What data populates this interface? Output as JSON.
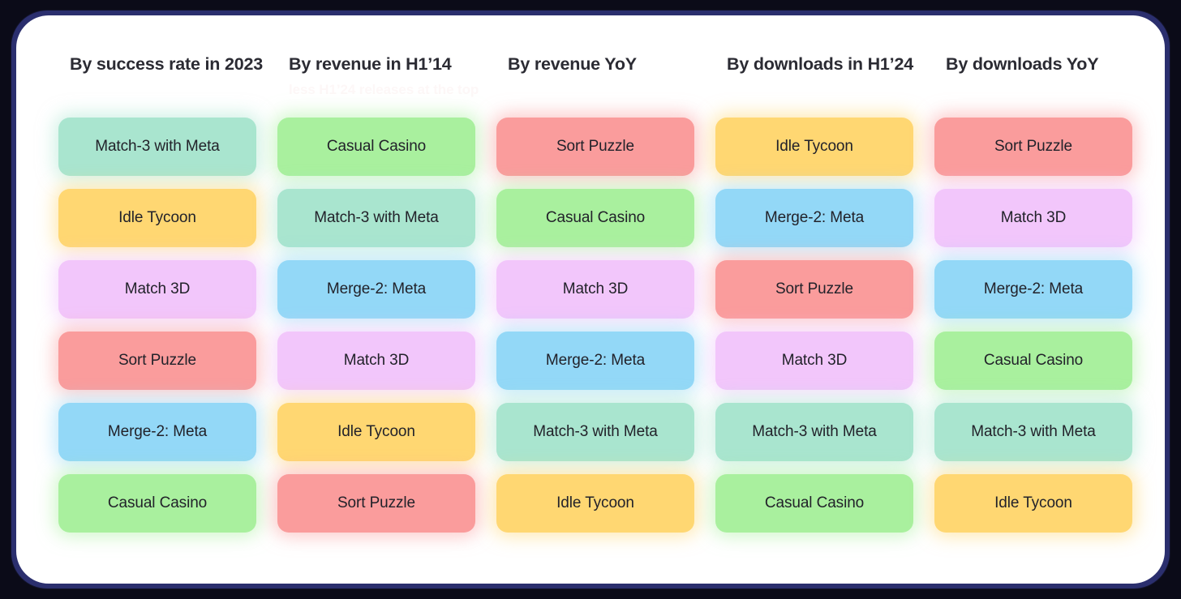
{
  "palette": {
    "background": "#0b0b18",
    "card": "#ffffff",
    "border_ring": "#2b2f6e",
    "title_text": "#2b2b33",
    "cell_text": "#22222a",
    "subtitle_text": "#fdf7f7",
    "mint": "#a9e5cf",
    "yellow": "#ffd772",
    "purple": "#f2c6fb",
    "salmon": "#fa9c9c",
    "sky": "#93d8f7",
    "green": "#a9f09e"
  },
  "columns": [
    {
      "title": "By success rate in 2023",
      "subtitle": "",
      "cells": [
        {
          "label": "Match-3 with Meta",
          "color": "mint"
        },
        {
          "label": "Idle Tycoon",
          "color": "yellow"
        },
        {
          "label": "Match 3D",
          "color": "purple"
        },
        {
          "label": "Sort Puzzle",
          "color": "salmon"
        },
        {
          "label": "Merge-2: Meta",
          "color": "sky"
        },
        {
          "label": "Casual Casino",
          "color": "green"
        }
      ]
    },
    {
      "title": "By revenue in H1’14",
      "subtitle": "less H1’24 releases at the top",
      "cells": [
        {
          "label": "Casual Casino",
          "color": "green"
        },
        {
          "label": "Match-3 with Meta",
          "color": "mint"
        },
        {
          "label": "Merge-2: Meta",
          "color": "sky"
        },
        {
          "label": "Match 3D",
          "color": "purple"
        },
        {
          "label": "Idle Tycoon",
          "color": "yellow"
        },
        {
          "label": "Sort Puzzle",
          "color": "salmon"
        }
      ]
    },
    {
      "title": "By revenue YoY",
      "subtitle": "",
      "cells": [
        {
          "label": "Sort Puzzle",
          "color": "salmon"
        },
        {
          "label": "Casual Casino",
          "color": "green"
        },
        {
          "label": "Match 3D",
          "color": "purple"
        },
        {
          "label": "Merge-2: Meta",
          "color": "sky"
        },
        {
          "label": "Match-3 with Meta",
          "color": "mint"
        },
        {
          "label": "Idle Tycoon",
          "color": "yellow"
        }
      ]
    },
    {
      "title": "By downloads in H1’24",
      "subtitle": "",
      "cells": [
        {
          "label": "Idle Tycoon",
          "color": "yellow"
        },
        {
          "label": "Merge-2: Meta",
          "color": "sky"
        },
        {
          "label": "Sort Puzzle",
          "color": "salmon"
        },
        {
          "label": "Match 3D",
          "color": "purple"
        },
        {
          "label": "Match-3 with Meta",
          "color": "mint"
        },
        {
          "label": "Casual Casino",
          "color": "green"
        }
      ]
    },
    {
      "title": "By downloads YoY",
      "subtitle": "",
      "cells": [
        {
          "label": "Sort Puzzle",
          "color": "salmon"
        },
        {
          "label": "Match 3D",
          "color": "purple"
        },
        {
          "label": "Merge-2: Meta",
          "color": "sky"
        },
        {
          "label": "Casual Casino",
          "color": "green"
        },
        {
          "label": "Match-3 with Meta",
          "color": "mint"
        },
        {
          "label": "Idle Tycoon",
          "color": "yellow"
        }
      ]
    }
  ]
}
